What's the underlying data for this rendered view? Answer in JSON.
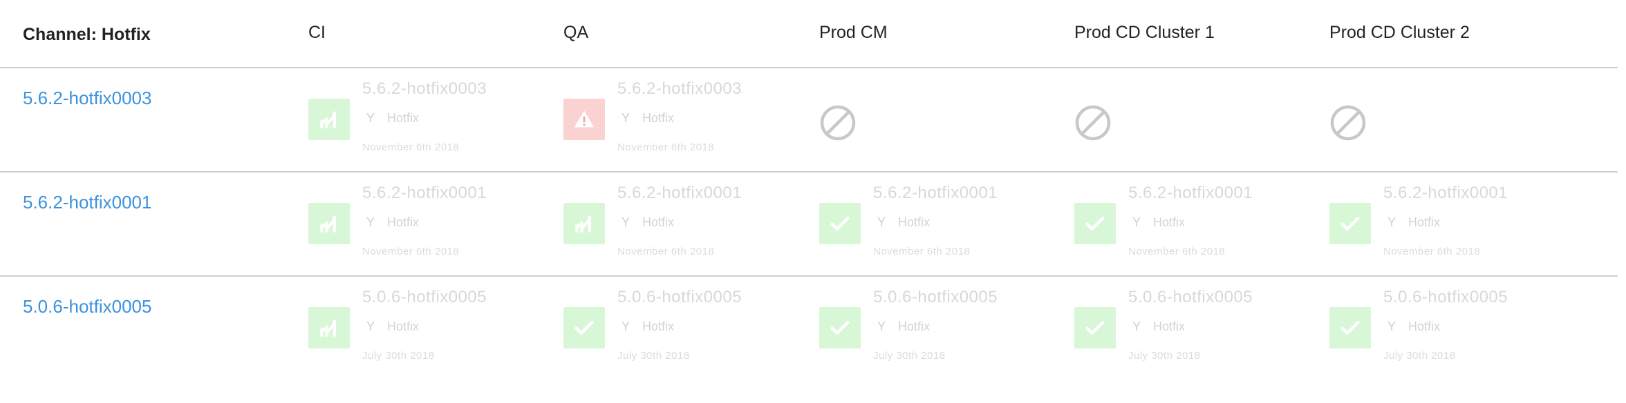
{
  "columns": [
    "Channel: Hotfix",
    "CI",
    "QA",
    "Prod CM",
    "Prod CD Cluster 1",
    "Prod CD Cluster 2"
  ],
  "colors": {
    "link": "#3b91df",
    "success_bg": "#d7f7d7",
    "fail_bg": "#fbd2d2",
    "disabled_icon": "#c8c8c8"
  },
  "rows": [
    {
      "release": "5.6.2-hotfix0003",
      "cells": [
        {
          "status": "success-cicd",
          "version": "5.6.2-hotfix0003",
          "channel": "Hotfix",
          "date": "November 6th 2018"
        },
        {
          "status": "failed",
          "version": "5.6.2-hotfix0003",
          "channel": "Hotfix",
          "date": "November 6th 2018"
        },
        {
          "status": "not-deployed"
        },
        {
          "status": "not-deployed"
        },
        {
          "status": "not-deployed"
        }
      ]
    },
    {
      "release": "5.6.2-hotfix0001",
      "cells": [
        {
          "status": "success-cicd",
          "version": "5.6.2-hotfix0001",
          "channel": "Hotfix",
          "date": "November 6th 2018"
        },
        {
          "status": "success-cicd",
          "version": "5.6.2-hotfix0001",
          "channel": "Hotfix",
          "date": "November 6th 2018"
        },
        {
          "status": "success",
          "version": "5.6.2-hotfix0001",
          "channel": "Hotfix",
          "date": "November 6th 2018"
        },
        {
          "status": "success",
          "version": "5.6.2-hotfix0001",
          "channel": "Hotfix",
          "date": "November 6th 2018"
        },
        {
          "status": "success",
          "version": "5.6.2-hotfix0001",
          "channel": "Hotfix",
          "date": "November 6th 2018"
        }
      ]
    },
    {
      "release": "5.0.6-hotfix0005",
      "cells": [
        {
          "status": "success-cicd",
          "version": "5.0.6-hotfix0005",
          "channel": "Hotfix",
          "date": "July 30th 2018"
        },
        {
          "status": "success",
          "version": "5.0.6-hotfix0005",
          "channel": "Hotfix",
          "date": "July 30th 2018"
        },
        {
          "status": "success",
          "version": "5.0.6-hotfix0005",
          "channel": "Hotfix",
          "date": "July 30th 2018"
        },
        {
          "status": "success",
          "version": "5.0.6-hotfix0005",
          "channel": "Hotfix",
          "date": "July 30th 2018"
        },
        {
          "status": "success",
          "version": "5.0.6-hotfix0005",
          "channel": "Hotfix",
          "date": "July 30th 2018"
        }
      ]
    }
  ]
}
